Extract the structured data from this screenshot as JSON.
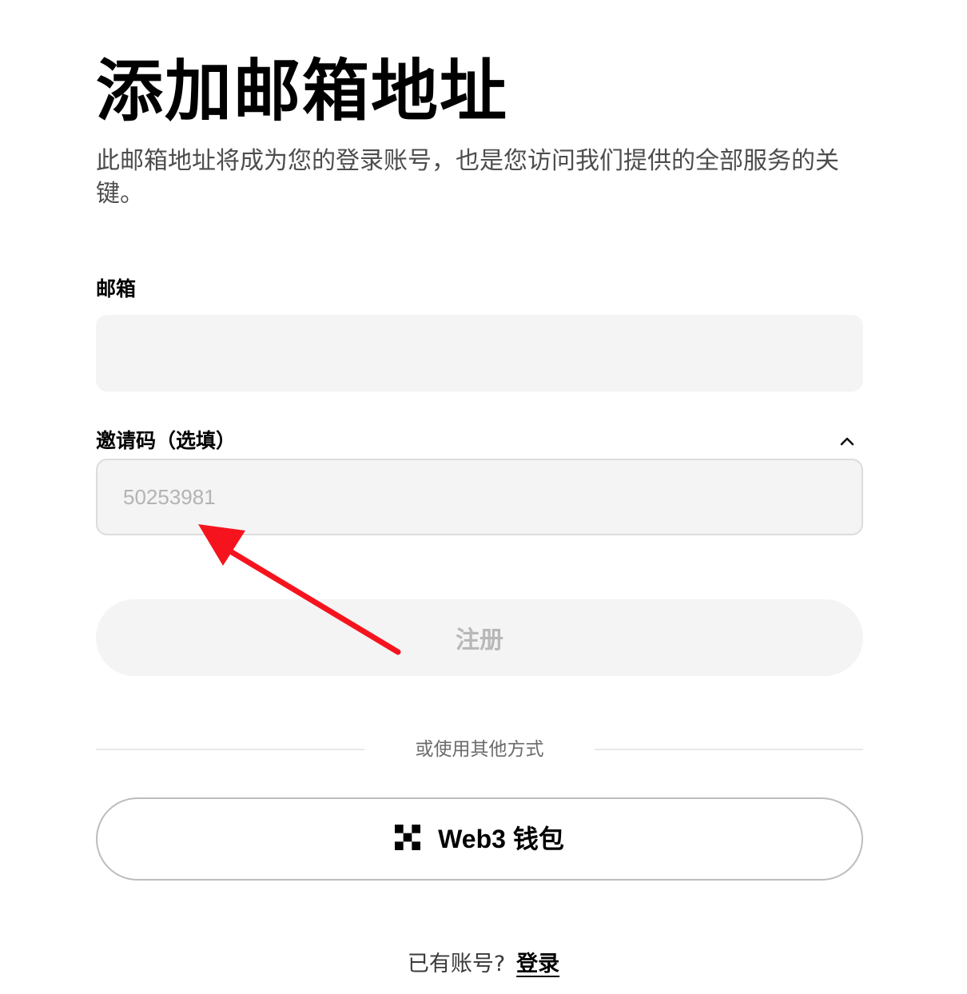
{
  "header": {
    "title": "添加邮箱地址",
    "subtitle": "此邮箱地址将成为您的登录账号，也是您访问我们提供的全部服务的关键。"
  },
  "form": {
    "email": {
      "label": "邮箱",
      "value": "",
      "placeholder": ""
    },
    "invite_code": {
      "label": "邀请码（选填）",
      "placeholder": "50253981",
      "expanded": true
    },
    "submit_label": "注册",
    "submit_enabled": false
  },
  "alternatives": {
    "divider_text": "或使用其他方式",
    "web3_label": "Web3 钱包",
    "web3_icon": "okx-logo-icon"
  },
  "footer": {
    "prompt": "已有账号?",
    "login_label": "登录"
  },
  "colors": {
    "annotation_arrow": "#f5141e",
    "input_background": "#f4f4f4",
    "disabled_text": "#b8b8b8"
  }
}
